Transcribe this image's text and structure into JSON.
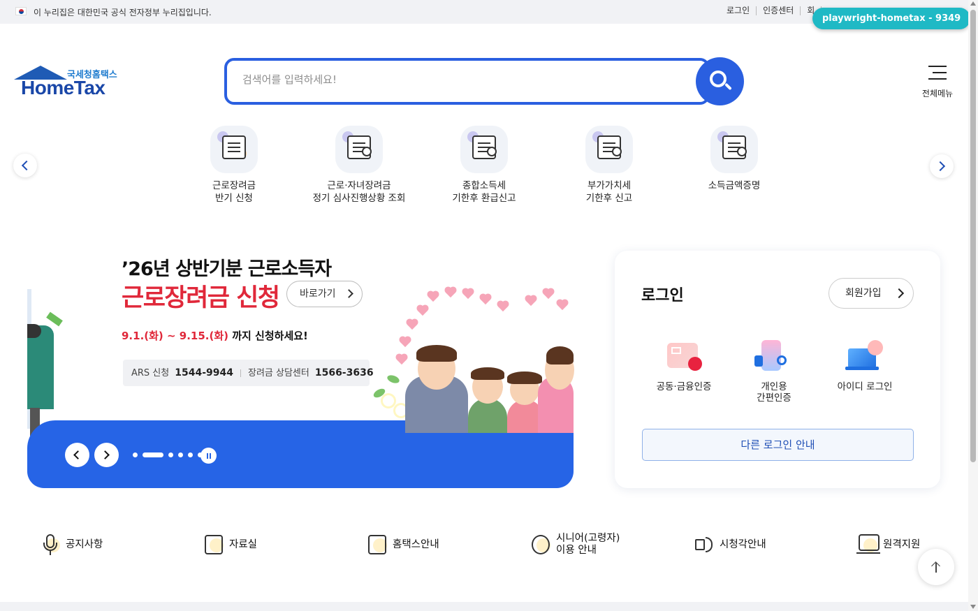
{
  "gov_bar": {
    "notice": "이 누리집은 대한민국 공식 전자정부 누리집입니다.",
    "links": [
      "로그인",
      "인증센터",
      "회"
    ]
  },
  "automation_badge": "playwright-hometax - 9349",
  "logo": {
    "sub": "국세청홈택스",
    "main": "HomeTax"
  },
  "search": {
    "placeholder": "검색어를 입력하세요!"
  },
  "all_menu": {
    "label": "전체메뉴"
  },
  "quick_menu": [
    {
      "label": "근로장려금\n반기 신청"
    },
    {
      "label": "근로·자녀장려금\n정기 심사진행상황 조회"
    },
    {
      "label": "종합소득세\n기한후 환급신고"
    },
    {
      "label": "부가가치세\n기한후 신고"
    },
    {
      "label": "소득금액증명"
    }
  ],
  "banner": {
    "line1": "’26년 상반기분 근로소득자",
    "line2": "근로장려금 신청",
    "go_label": "바로가기",
    "date_red": "9.1.(화) ~ 9.15.(화)",
    "date_rest": " 까지 신청하세요!",
    "ars_label": "ARS 신청",
    "ars_number": "1544-9944",
    "center_label": "장려금 상담센터",
    "center_number": "1566-3636",
    "pages_total": 6,
    "page_active": 2
  },
  "login": {
    "title": "로그인",
    "signup": "회원가입",
    "options": [
      {
        "label": "공동·금융인증"
      },
      {
        "label": "개인용\n간편인증"
      },
      {
        "label": "아이디 로그인"
      }
    ],
    "other": "다른 로그인 안내"
  },
  "bottom_links": [
    {
      "label": "공지사항"
    },
    {
      "label": "자료실"
    },
    {
      "label": "홈택스안내"
    },
    {
      "label": "시니어(고령자)\n이용 안내"
    },
    {
      "label": "시청각안내"
    },
    {
      "label": "원격지원"
    }
  ]
}
